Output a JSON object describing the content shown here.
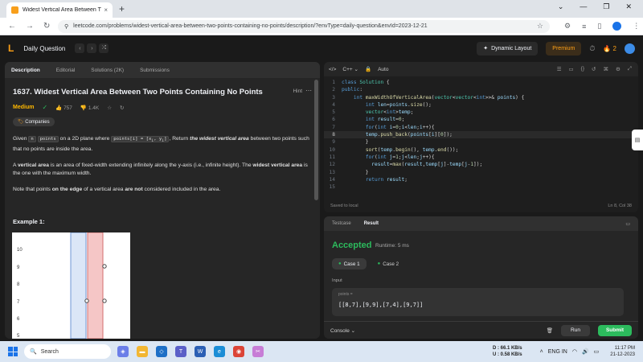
{
  "browser": {
    "tab_title": "Widest Vertical Area Between T",
    "tab_close": "×",
    "new_tab": "+",
    "url": "leetcode.com/problems/widest-vertical-area-between-two-points-containing-no-points/description/?envType=daily-question&envId=2023-12-21",
    "nav_back": "←",
    "nav_forward": "→",
    "nav_reload": "↻",
    "profile_initial": ""
  },
  "header": {
    "logo": "L",
    "title": "Daily Question",
    "dynamic_layout": "Dynamic Layout",
    "premium": "Premium",
    "streak": "2"
  },
  "problem": {
    "tabs": [
      "Description",
      "Editorial",
      "Solutions (2K)",
      "Submissions"
    ],
    "title": "1637. Widest Vertical Area Between Two Points Containing No Points",
    "hint": "Hint",
    "difficulty": "Medium",
    "likes": "757",
    "dislikes": "1.4K",
    "companies": "Companies",
    "example_title": "Example 1:",
    "plot_y_labels": [
      "10",
      "9",
      "8",
      "7",
      "6",
      "5"
    ]
  },
  "editor": {
    "language": "C++",
    "mode": "Auto",
    "saved": "Saved to local",
    "cursor": "Ln 8, Col 38"
  },
  "result": {
    "tabs": [
      "Testcase",
      "Result"
    ],
    "status": "Accepted",
    "runtime": "Runtime: 5 ms",
    "cases": [
      "Case 1",
      "Case 2"
    ],
    "input_label": "Input",
    "var_name": "points =",
    "input_value": "[[8,7],[9,9],[7,4],[9,7]]",
    "console": "Console",
    "run": "Run",
    "submit": "Submit"
  },
  "taskbar": {
    "search": "Search",
    "download": "D : 66.1 KB/s",
    "upload": "U : 0.58 KB/s",
    "lang": "ENG IN",
    "time": "11:17 PM",
    "date": "21-12-2023"
  }
}
